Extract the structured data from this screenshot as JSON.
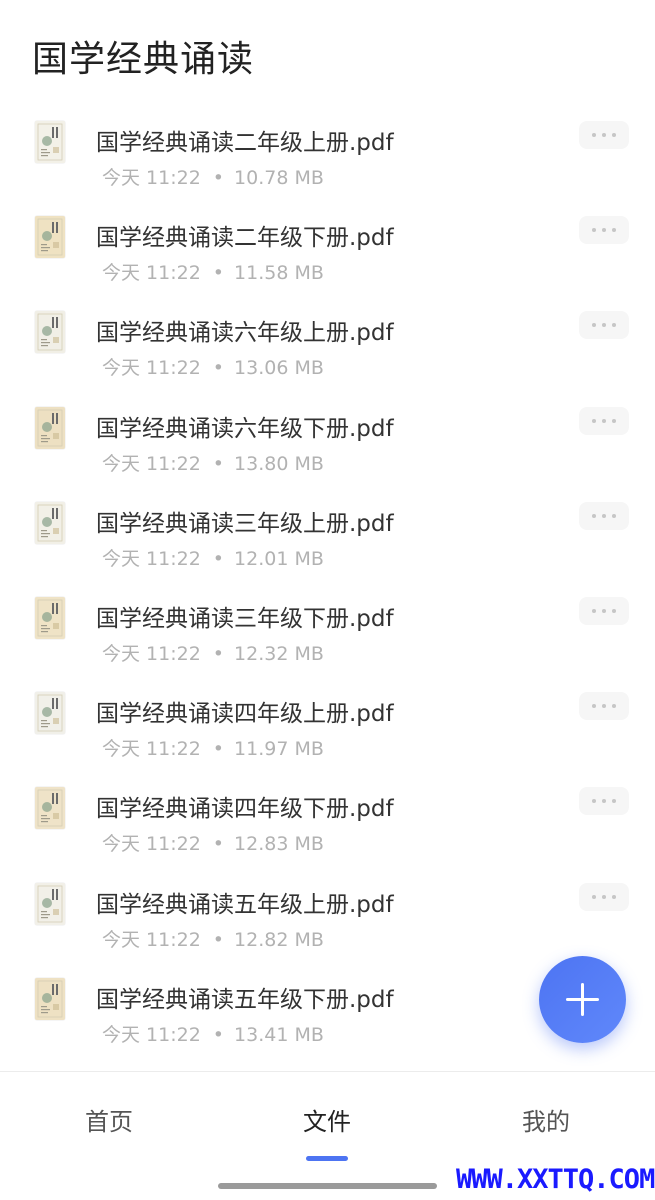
{
  "header": {
    "title": "国学经典诵读"
  },
  "files": [
    {
      "name": "国学经典诵读二年级上册.pdf",
      "date": "今天 11:22",
      "size": "10.78 MB",
      "thumb_tint": "#f3f1e8"
    },
    {
      "name": "国学经典诵读二年级下册.pdf",
      "date": "今天 11:22",
      "size": "11.58 MB",
      "thumb_tint": "#efe2c2"
    },
    {
      "name": "国学经典诵读六年级上册.pdf",
      "date": "今天 11:22",
      "size": "13.06 MB",
      "thumb_tint": "#f1efe6"
    },
    {
      "name": "国学经典诵读六年级下册.pdf",
      "date": "今天 11:22",
      "size": "13.80 MB",
      "thumb_tint": "#ede0c2"
    },
    {
      "name": "国学经典诵读三年级上册.pdf",
      "date": "今天 11:22",
      "size": "12.01 MB",
      "thumb_tint": "#f2f0e7"
    },
    {
      "name": "国学经典诵读三年级下册.pdf",
      "date": "今天 11:22",
      "size": "12.32 MB",
      "thumb_tint": "#efe3c6"
    },
    {
      "name": "国学经典诵读四年级上册.pdf",
      "date": "今天 11:22",
      "size": "11.97 MB",
      "thumb_tint": "#f1f0e9"
    },
    {
      "name": "国学经典诵读四年级下册.pdf",
      "date": "今天 11:22",
      "size": "12.83 MB",
      "thumb_tint": "#efe3c8"
    },
    {
      "name": "国学经典诵读五年级上册.pdf",
      "date": "今天 11:22",
      "size": "12.82 MB",
      "thumb_tint": "#f2f0e8"
    },
    {
      "name": "国学经典诵读五年级下册.pdf",
      "date": "今天 11:22",
      "size": "13.41 MB",
      "thumb_tint": "#eee1c3"
    }
  ],
  "meta_separator": "•",
  "fab": {
    "icon": "plus-icon",
    "color": "#4d74f2"
  },
  "bottom_nav": {
    "tabs": [
      {
        "label": "首页",
        "active": false
      },
      {
        "label": "文件",
        "active": true
      },
      {
        "label": "我的",
        "active": false
      }
    ],
    "indicator_color": "#4d74f2"
  },
  "watermark": "WWW.XXTTQ.COM",
  "icons": {
    "file_thumbnail": "pdf-thumbnail-icon",
    "more": "more-dots-icon"
  }
}
